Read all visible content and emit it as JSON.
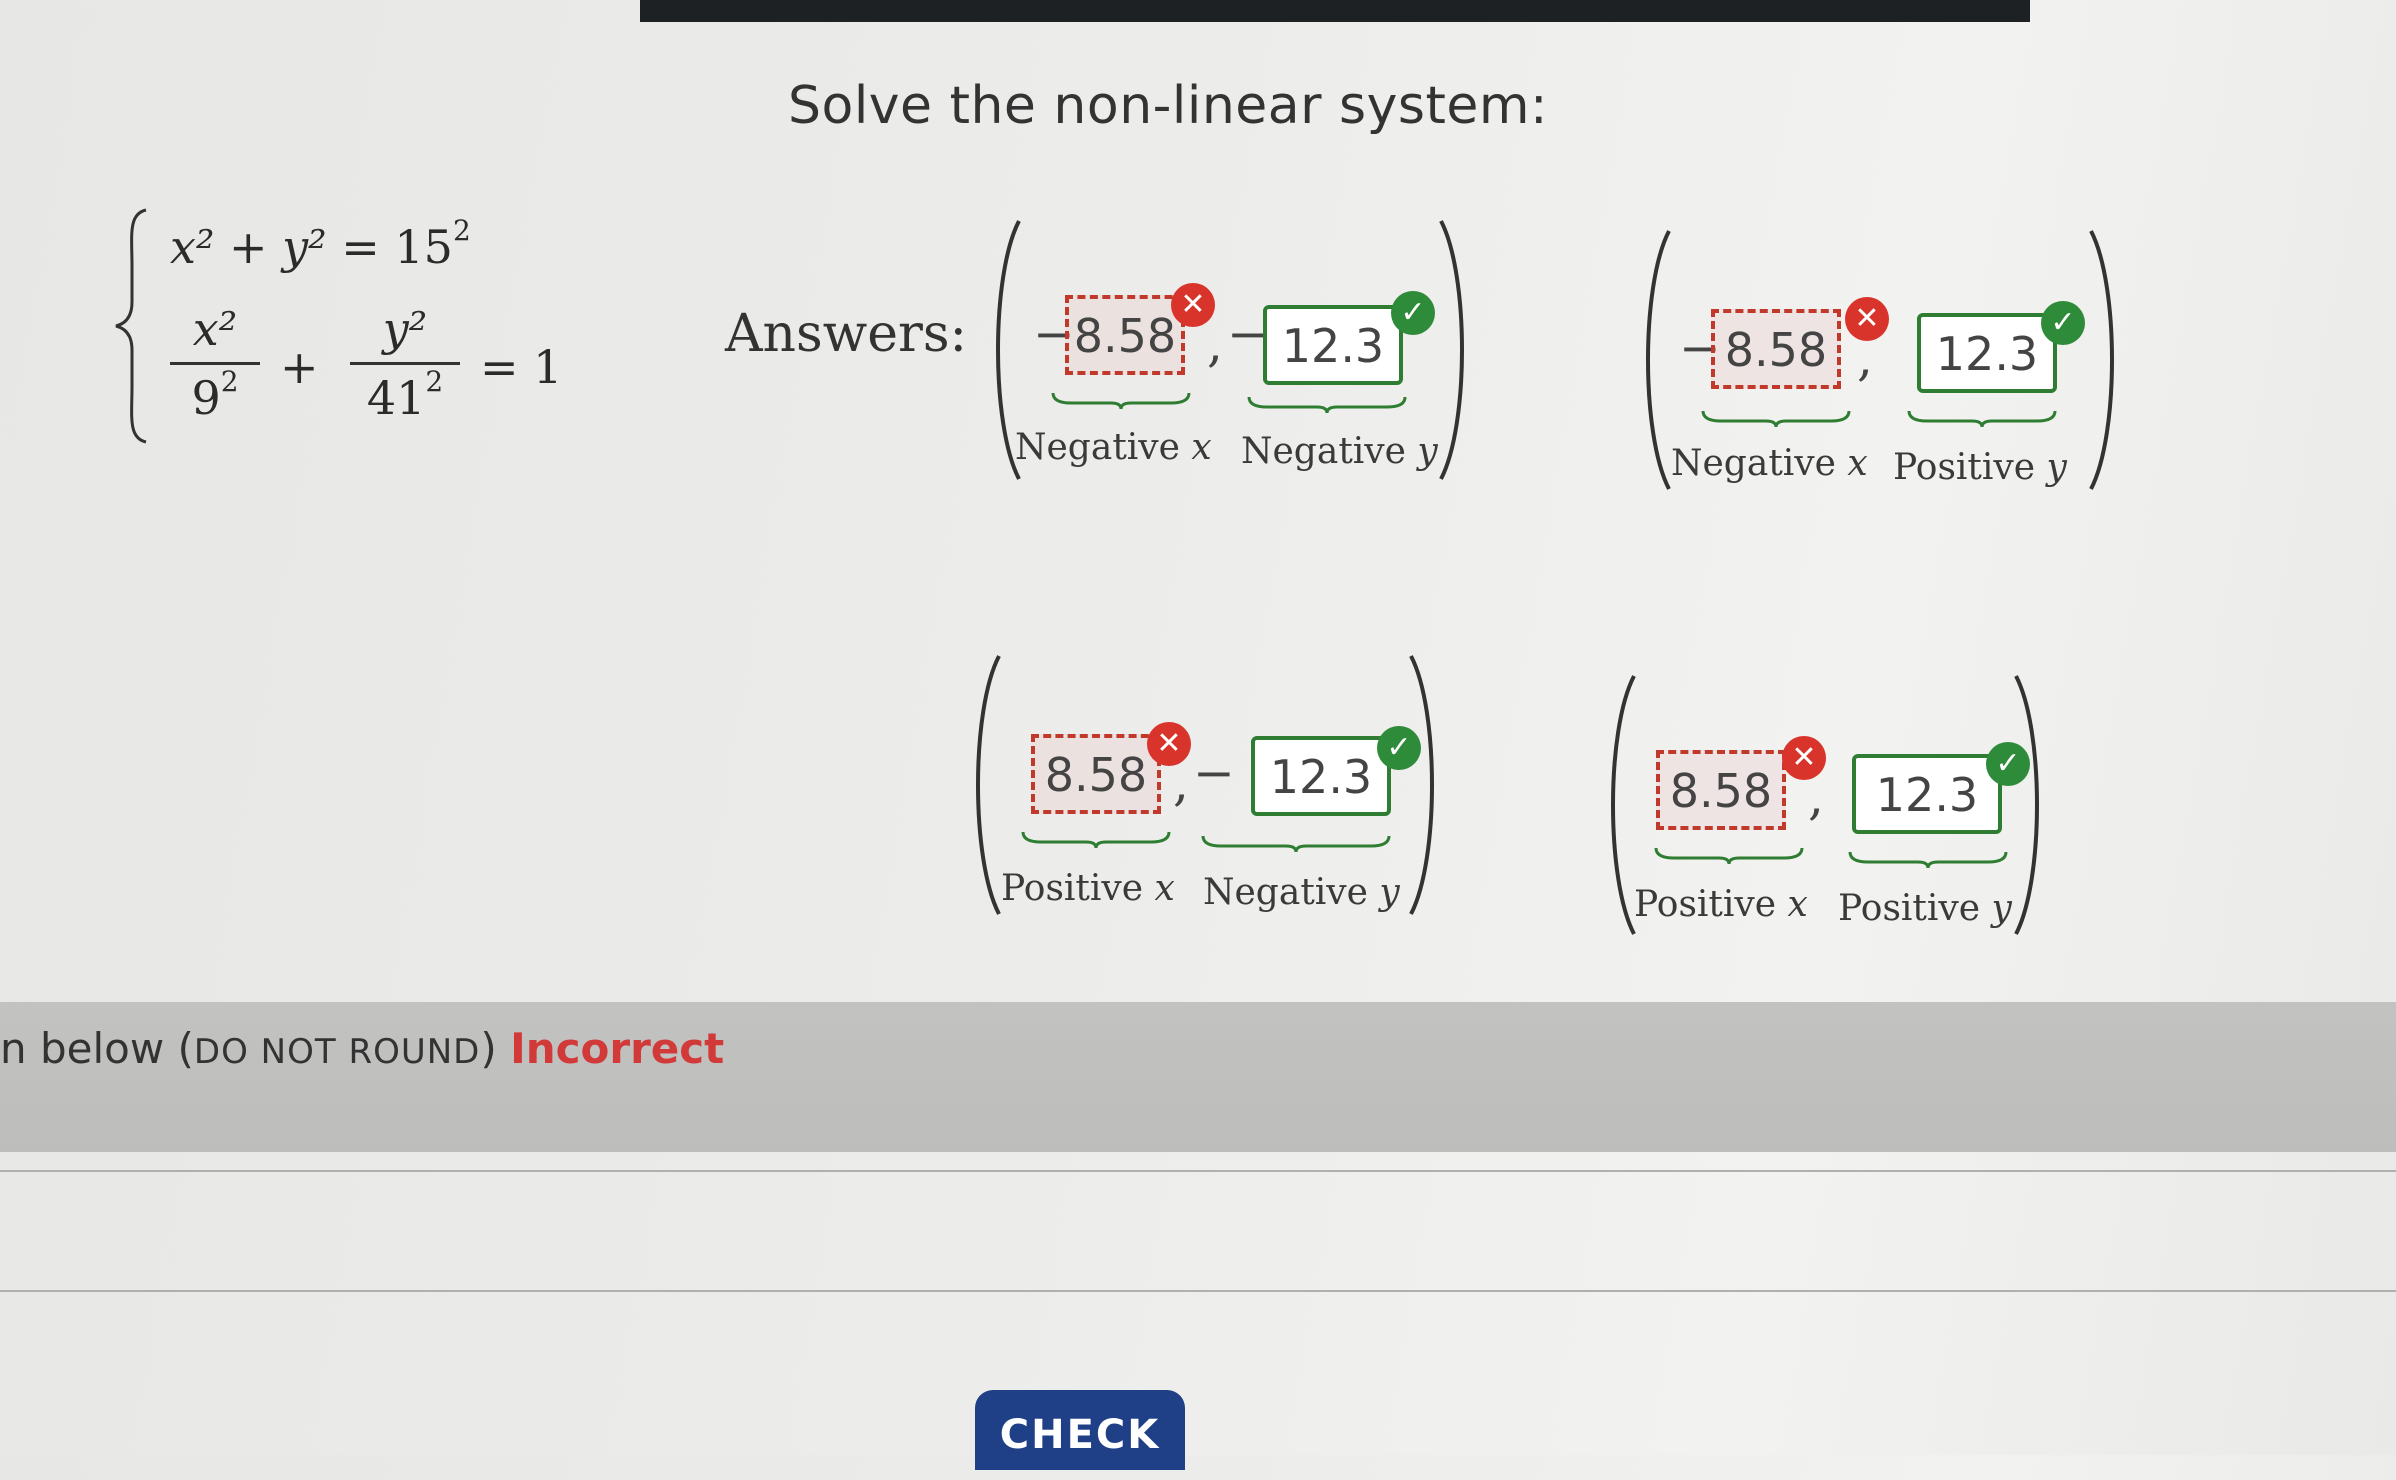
{
  "problem": {
    "title": "Solve the non-linear system:",
    "eq1": {
      "lhs": "x² + y² =",
      "rhs_base": "15",
      "rhs_exp": "2"
    },
    "eq2": {
      "term1_num": "x²",
      "term1_den_base": "9",
      "term1_den_exp": "2",
      "plus": "+",
      "term2_num": "y²",
      "term2_den_base": "41",
      "term2_den_exp": "2",
      "rhs": "= 1"
    }
  },
  "answers_label": "Answers:",
  "pairs": [
    {
      "x_sign": "−",
      "x_value": "8.58",
      "x_status": "incorrect",
      "y_sign": "−",
      "y_value": "12.3",
      "y_status": "correct",
      "x_label": "Negative",
      "x_var": "x",
      "y_label": "Negative",
      "y_var": "y"
    },
    {
      "x_sign": "−",
      "x_value": "8.58",
      "x_status": "incorrect",
      "y_sign": "",
      "y_value": "12.3",
      "y_status": "correct",
      "x_label": "Negative",
      "x_var": "x",
      "y_label": "Positive",
      "y_var": "y"
    },
    {
      "x_sign": "",
      "x_value": "8.58",
      "x_status": "incorrect",
      "y_sign": "−",
      "y_value": "12.3",
      "y_status": "correct",
      "x_label": "Positive",
      "x_var": "x",
      "y_label": "Negative",
      "y_var": "y"
    },
    {
      "x_sign": "",
      "x_value": "8.58",
      "x_status": "incorrect",
      "y_sign": "",
      "y_value": "12.3",
      "y_status": "correct",
      "x_label": "Positive",
      "x_var": "x",
      "y_label": "Positive",
      "y_var": "y"
    }
  ],
  "comma": ",",
  "badges": {
    "incorrect": "✕",
    "correct": "✓"
  },
  "feedback": {
    "prefix": "n below (",
    "emphasis": "DO NOT ROUND",
    "suffix": ")",
    "status": "Incorrect"
  },
  "check_button": "CHECK",
  "colors": {
    "incorrect": "#d9342b",
    "correct": "#2e8b3a",
    "button": "#1f3f86"
  }
}
